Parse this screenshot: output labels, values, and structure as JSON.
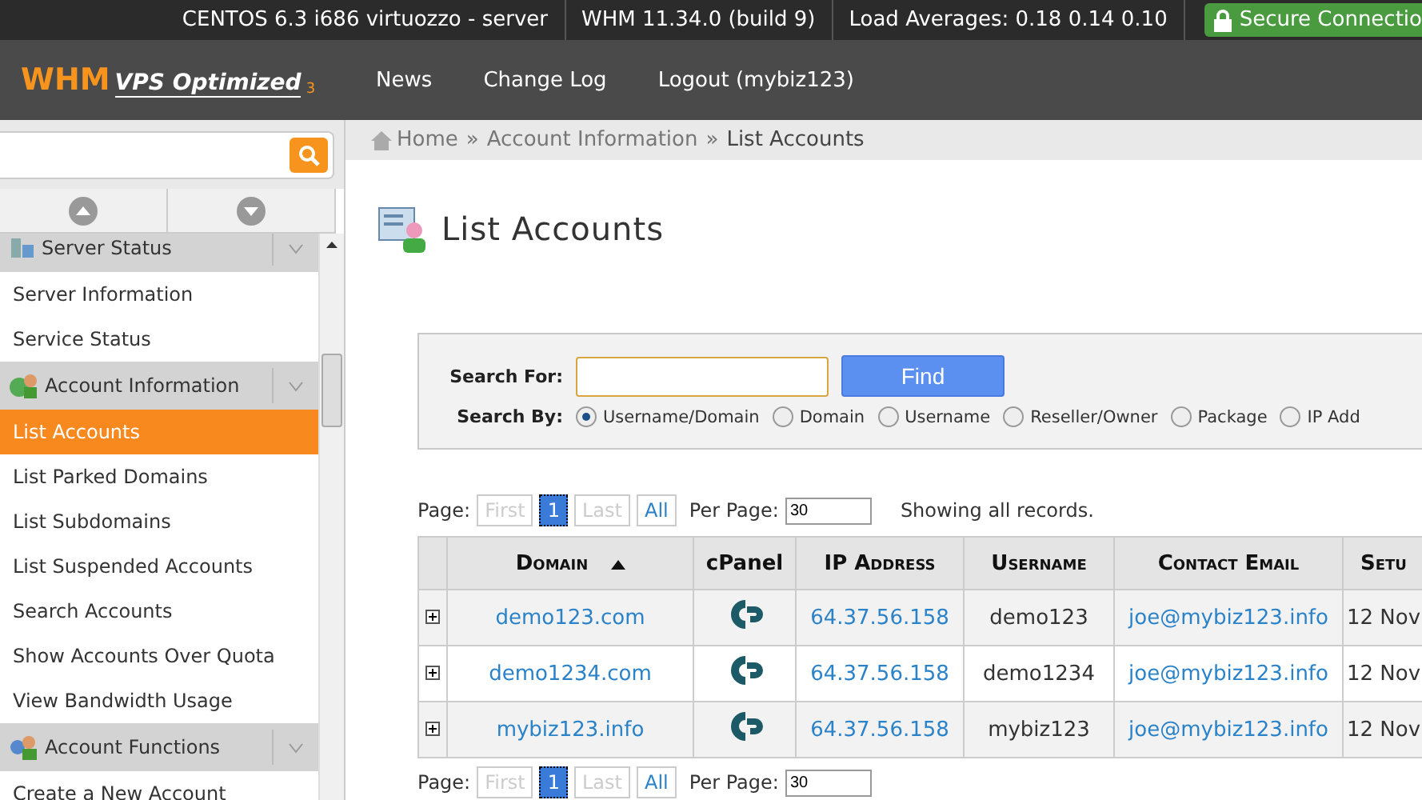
{
  "top_bar": {
    "items": [
      "CENTOS 6.3 i686 virtuozzo - server",
      "WHM 11.34.0 (build 9)",
      "Load Averages: 0.18 0.14 0.10"
    ],
    "secure": "Secure Connectio"
  },
  "header": {
    "logo": "WHM",
    "logo_sub": "VPS Optimized",
    "logo_sup": "3",
    "nav": [
      "News",
      "Change Log",
      "Logout (mybiz123)"
    ]
  },
  "sidebar": {
    "sections": [
      {
        "title": "Server Status",
        "items": [
          {
            "label": "Server Information",
            "selected": false
          },
          {
            "label": "Service Status",
            "selected": false
          }
        ]
      },
      {
        "title": "Account Information",
        "items": [
          {
            "label": "List Accounts",
            "selected": true
          },
          {
            "label": "List Parked Domains",
            "selected": false
          },
          {
            "label": "List Subdomains",
            "selected": false
          },
          {
            "label": "List Suspended Accounts",
            "selected": false
          },
          {
            "label": "Search Accounts",
            "selected": false
          },
          {
            "label": "Show Accounts Over Quota",
            "selected": false
          },
          {
            "label": "View Bandwidth Usage",
            "selected": false
          }
        ]
      },
      {
        "title": "Account Functions",
        "items": [
          {
            "label": "Create a New Account",
            "selected": false
          }
        ]
      }
    ]
  },
  "breadcrumb": {
    "items": [
      "Home",
      "Account Information",
      "List Accounts"
    ],
    "separator": "»"
  },
  "page_title": "List Accounts",
  "search": {
    "label": "Search For:",
    "button": "Find",
    "by_label": "Search By:",
    "options": [
      {
        "label": "Username/Domain",
        "selected": true
      },
      {
        "label": "Domain",
        "selected": false
      },
      {
        "label": "Username",
        "selected": false
      },
      {
        "label": "Reseller/Owner",
        "selected": false
      },
      {
        "label": "Package",
        "selected": false
      },
      {
        "label": "IP Add",
        "selected": false
      }
    ]
  },
  "pagers": [
    {
      "label": "Page:",
      "buttons": [
        {
          "label": "First",
          "disabled": true,
          "selected": false
        },
        {
          "label": "1",
          "disabled": false,
          "selected": true
        },
        {
          "label": "Last",
          "disabled": true,
          "selected": false
        },
        {
          "label": "All",
          "disabled": false,
          "selected": false
        }
      ],
      "per_page_label": "Per Page:",
      "per_page": "30",
      "status": "Showing all records."
    },
    {
      "label": "Page:",
      "buttons": [
        {
          "label": "First",
          "disabled": true,
          "selected": false
        },
        {
          "label": "1",
          "disabled": false,
          "selected": true
        },
        {
          "label": "Last",
          "disabled": true,
          "selected": false
        },
        {
          "label": "All",
          "disabled": false,
          "selected": false
        }
      ],
      "per_page_label": "Per Page:",
      "per_page": "30"
    }
  ],
  "table": {
    "columns": [
      {
        "label": "Domain",
        "sorted": true
      },
      {
        "label": "cPanel",
        "sorted": false
      },
      {
        "label": "IP Address",
        "sorted": false
      },
      {
        "label": "Username",
        "sorted": false
      },
      {
        "label": "Contact Email",
        "sorted": false
      },
      {
        "label": "Setu",
        "sorted": false
      }
    ],
    "rows": [
      {
        "domain": "demo123.com",
        "ip": "64.37.56.158",
        "username": "demo123",
        "email": "joe@mybiz123.info",
        "setup": "12 Nov"
      },
      {
        "domain": "demo1234.com",
        "ip": "64.37.56.158",
        "username": "demo1234",
        "email": "joe@mybiz123.info",
        "setup": "12 Nov"
      },
      {
        "domain": "mybiz123.info",
        "ip": "64.37.56.158",
        "username": "mybiz123",
        "email": "joe@mybiz123.info",
        "setup": "12 Nov"
      }
    ]
  }
}
